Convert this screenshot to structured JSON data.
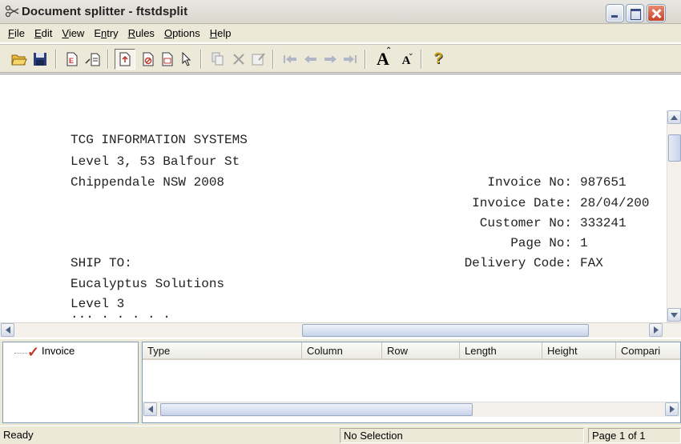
{
  "window": {
    "title": "Document splitter - ftstdsplit"
  },
  "menu": [
    {
      "pre": "",
      "ul": "F",
      "post": "ile"
    },
    {
      "pre": "",
      "ul": "E",
      "post": "dit"
    },
    {
      "pre": "",
      "ul": "V",
      "post": "iew"
    },
    {
      "pre": "E",
      "ul": "n",
      "post": "try"
    },
    {
      "pre": "",
      "ul": "R",
      "post": "ules"
    },
    {
      "pre": "",
      "ul": "O",
      "post": "ptions"
    },
    {
      "pre": "",
      "ul": "H",
      "post": "elp"
    }
  ],
  "toolbar": {
    "font_larger_glyph": "A",
    "font_smaller_glyph": "A",
    "help_glyph": "?"
  },
  "document": {
    "lines_left": [
      "TCG INFORMATION SYSTEMS",
      "Level 3, 53 Balfour St",
      "Chippendale NSW 2008",
      "SHIP TO:",
      "Eucalyptus Solutions",
      "Level 3"
    ],
    "fields": [
      {
        "label": "Invoice No:",
        "value": "987651"
      },
      {
        "label": "Invoice Date:",
        "value": "28/04/200"
      },
      {
        "label": "Customer No:",
        "value": "333241"
      },
      {
        "label": "Page No:",
        "value": "1"
      },
      {
        "label": "Delivery Code:",
        "value": "FAX"
      }
    ]
  },
  "tree": {
    "item": "Invoice"
  },
  "grid": {
    "columns": [
      "Type",
      "Column",
      "Row",
      "Length",
      "Height",
      "Compari"
    ]
  },
  "status": {
    "left": "Ready",
    "middle": "No Selection",
    "right": "Page 1 of 1"
  }
}
